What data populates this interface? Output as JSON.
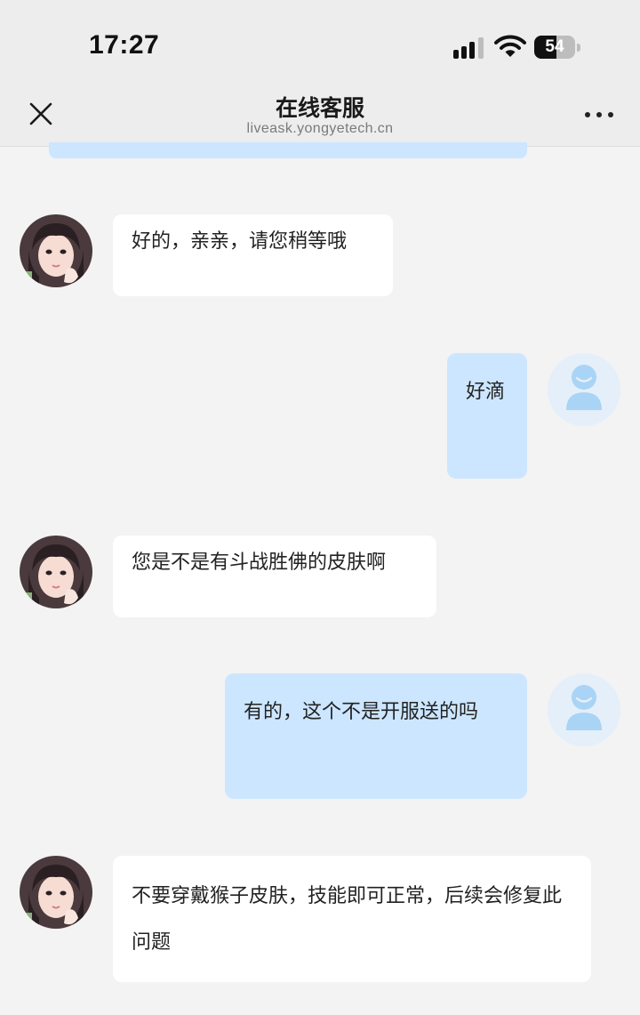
{
  "status_bar": {
    "time": "17:27",
    "battery": "54",
    "battery_level": 0.54
  },
  "nav": {
    "title": "在线客服",
    "subtitle": "liveask.yongyetech.cn",
    "close_icon": "close-icon",
    "more_icon": "more-icon"
  },
  "messages": [
    {
      "side": "agent",
      "text": "好的，亲亲，请您稍等哦"
    },
    {
      "side": "user",
      "text": "好滴"
    },
    {
      "side": "agent",
      "text": "您是不是有斗战胜佛的皮肤啊"
    },
    {
      "side": "user",
      "text": "有的，这个不是开服送的吗"
    },
    {
      "side": "agent",
      "text": "不要穿戴猴子皮肤，技能即可正常，后续会修复此问题"
    }
  ],
  "colors": {
    "user_bubble": "#cce6ff",
    "agent_bubble": "#ffffff",
    "background": "#f3f3f3",
    "user_avatar_bg": "#e4eff9",
    "user_avatar_fg": "#a9d4f5"
  }
}
